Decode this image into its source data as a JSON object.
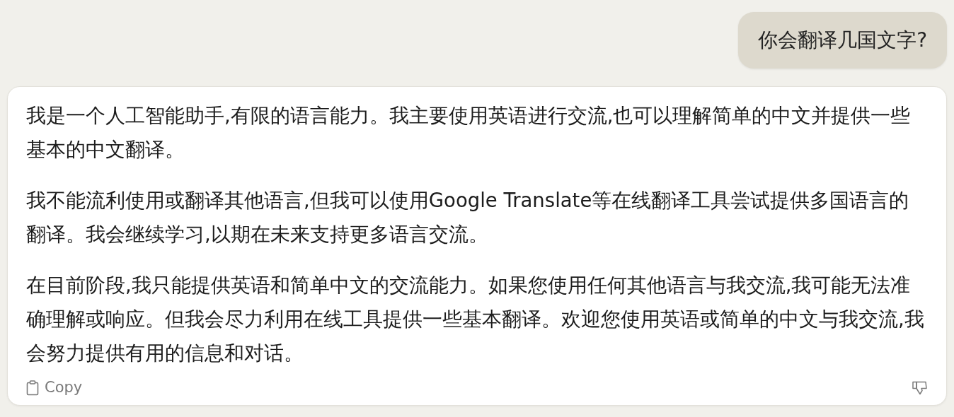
{
  "user_message": {
    "text": "你会翻译几国文字?"
  },
  "assistant_message": {
    "paragraphs": [
      "我是一个人工智能助手,有限的语言能力。我主要使用英语进行交流,也可以理解简单的中文并提供一些基本的中文翻译。",
      "我不能流利使用或翻译其他语言,但我可以使用Google Translate等在线翻译工具尝试提供多国语言的翻译。我会继续学习,以期在未来支持更多语言交流。",
      "在目前阶段,我只能提供英语和简单中文的交流能力。如果您使用任何其他语言与我交流,我可能无法准确理解或响应。但我会尽力利用在线工具提供一些基本翻译。欢迎您使用英语或简单的中文与我交流,我会努力提供有用的信息和对话。"
    ],
    "copy_label": "Copy"
  }
}
